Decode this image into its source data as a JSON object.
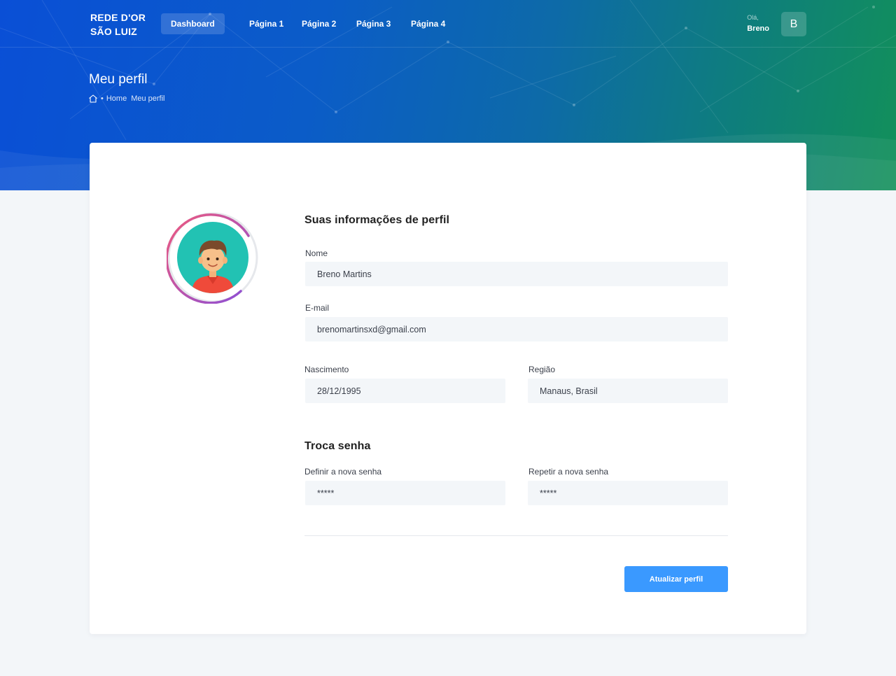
{
  "brand": {
    "logo_line1": "REDE D'OR",
    "logo_line2": "SÃO LUIZ"
  },
  "nav": {
    "items": [
      {
        "label": "Dashboard",
        "active": true
      },
      {
        "label": "Página 1"
      },
      {
        "label": "Página 2"
      },
      {
        "label": "Página 3"
      },
      {
        "label": "Página 4"
      }
    ]
  },
  "user": {
    "greeting": "Olá,",
    "name": "Breno",
    "initial": "B"
  },
  "header": {
    "title": "Meu perfil",
    "breadcrumb_separator": "•",
    "breadcrumb_home": "Home",
    "breadcrumb_current": "Meu perfil"
  },
  "profile": {
    "section_title": "Suas informações de perfil",
    "name_label": "Nome",
    "name_value": "Breno Martins",
    "email_label": "E-mail",
    "email_value": "brenomartinsxd@gmail.com",
    "birth_label": "Nascimento",
    "birth_value": "28/12/1995",
    "region_label": "Região",
    "region_value": "Manaus, Brasil"
  },
  "password": {
    "section_title": "Troca  senha",
    "new_label": "Definir a nova senha",
    "new_value": "*****",
    "repeat_label": "Repetir a nova senha",
    "repeat_value": "*****"
  },
  "actions": {
    "submit_label": "Atualizar perfil"
  },
  "colors": {
    "banner_start": "#0a4fd6",
    "banner_end": "#12905a",
    "primary_button": "#3a99ff",
    "input_bg": "#f3f6f9",
    "ring_start": "#e8578a",
    "ring_end": "#8a4fd8",
    "avatar_bg": "#22c2b3"
  }
}
